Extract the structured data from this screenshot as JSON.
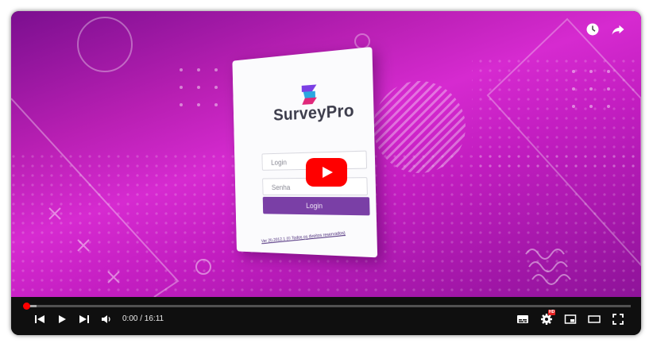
{
  "brand": {
    "name": "SurveyPro"
  },
  "login_form": {
    "login_placeholder": "Login",
    "password_placeholder": "Senha",
    "button_label": "Login",
    "footer_text": "Ver 20.2012.1 (© Todos os direitos reservados)"
  },
  "controls": {
    "time": "0:00 / 16:11",
    "progress_fraction": 0,
    "hd_badge": "HD"
  },
  "icons": {
    "watch_later": "clock-icon",
    "share": "share-icon",
    "play_overlay": "youtube-play-icon",
    "previous": "skip-previous-icon",
    "play": "play-icon",
    "next": "skip-next-icon",
    "volume": "volume-icon",
    "subtitles": "subtitles-icon",
    "settings": "gear-icon",
    "miniplayer": "miniplayer-icon",
    "theater": "theater-mode-icon",
    "fullscreen": "fullscreen-icon"
  },
  "colors": {
    "accent": "#ff0000",
    "background_magenta": "#c21dc0",
    "button_purple": "#7a3fa6"
  }
}
